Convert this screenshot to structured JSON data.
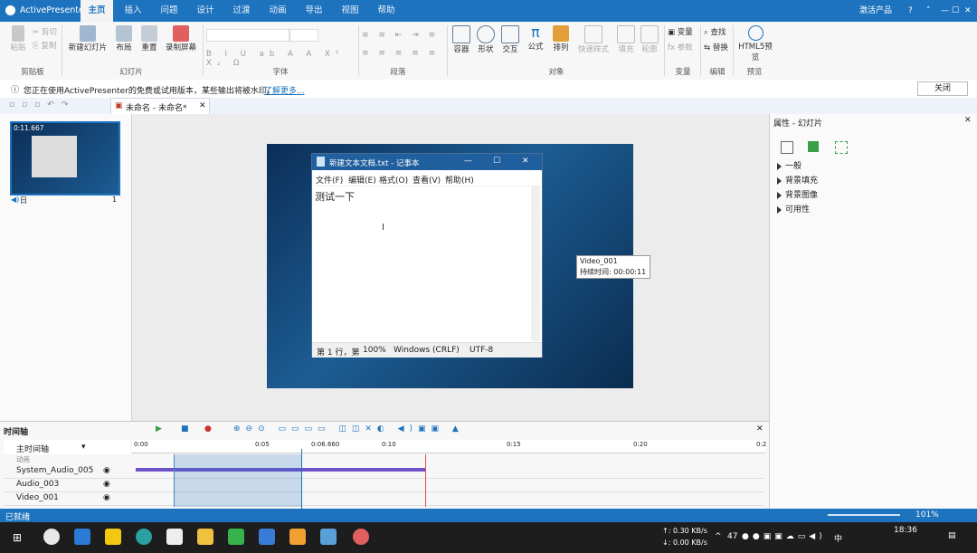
{
  "app": {
    "title": "ActivePresenter"
  },
  "menu_tabs": [
    "主页",
    "插入",
    "问题",
    "设计",
    "过渡",
    "动画",
    "导出",
    "视图",
    "帮助"
  ],
  "window_controls": {
    "activate": "激活产品",
    "help": "?",
    "pin": "˄",
    "minimize": "—",
    "maximize": "☐",
    "close": "✕"
  },
  "ribbon": {
    "clipboard": {
      "paste": "粘贴",
      "cut": "剪切",
      "copy": "复制",
      "group": "剪贴板"
    },
    "slides": {
      "new_slide": "新建幻灯片",
      "layout": "布局",
      "reset": "重置",
      "record": "录制屏幕",
      "group": "幻灯片"
    },
    "font": {
      "group": "字体",
      "buttons": [
        "B",
        "I",
        "U",
        "ab",
        "A",
        "",
        "A",
        "X²",
        "X₂",
        "Ω",
        "⌀",
        "Aa"
      ]
    },
    "paragraph": {
      "group": "段落"
    },
    "objects": {
      "container": "容器",
      "shape": "形状",
      "interaction": "交互",
      "formula": "公式",
      "arrange": "排列",
      "quick_style": "快速样式",
      "fill": "填充",
      "outline": "轮廓",
      "group": "对象"
    },
    "variables": {
      "variable": "变量",
      "param": "参数",
      "group": "变量"
    },
    "editing": {
      "find": "查找",
      "replace": "替换",
      "group": "编辑"
    },
    "preview": {
      "html5": "HTML5预览",
      "group": "预览"
    }
  },
  "infobar": {
    "message": "您正在使用ActivePresenter的免费或试用版本，某些输出将被水印。",
    "learn_more": "了解更多...",
    "close": "关闭"
  },
  "doc_tab": {
    "name": "未命名 - 未命名*"
  },
  "slide_thumb": {
    "time": "0:11.667",
    "label": "日",
    "number": "1"
  },
  "notepad": {
    "title": "新建文本文档.txt - 记事本",
    "menus": [
      "文件(F)",
      "编辑(E)",
      "格式(O)",
      "查看(V)",
      "帮助(H)"
    ],
    "content": "测试一下",
    "status": [
      "第 1 行，第",
      "100%",
      "Windows (CRLF)",
      "UTF-8"
    ]
  },
  "tooltip": {
    "name": "Video_001",
    "duration": "持续时间: 00:00:11"
  },
  "props": {
    "title": "属性 - 幻灯片",
    "sections": [
      "一般",
      "背景填充",
      "背景图像",
      "可用性"
    ]
  },
  "timeline": {
    "title": "时间轴",
    "main_track": "主时间轴",
    "ticks": [
      "0:00",
      "0:05",
      "0:06.660",
      "0:10",
      "0:15",
      "0:20",
      "0:2"
    ],
    "tracks": [
      "System_Audio_005",
      "Audio_003",
      "Video_001"
    ],
    "partial_track": "动画"
  },
  "status": {
    "left": "已就绪",
    "zoom": "101%"
  },
  "taskbar": {
    "network_up": "↑: 0.30 KB/s",
    "network_down": "↓: 0.00 KB/s",
    "temp": "47",
    "ime": "中",
    "time": "18:36"
  },
  "colors": {
    "accent": "#1e73be",
    "stage": "#0b2e58"
  }
}
